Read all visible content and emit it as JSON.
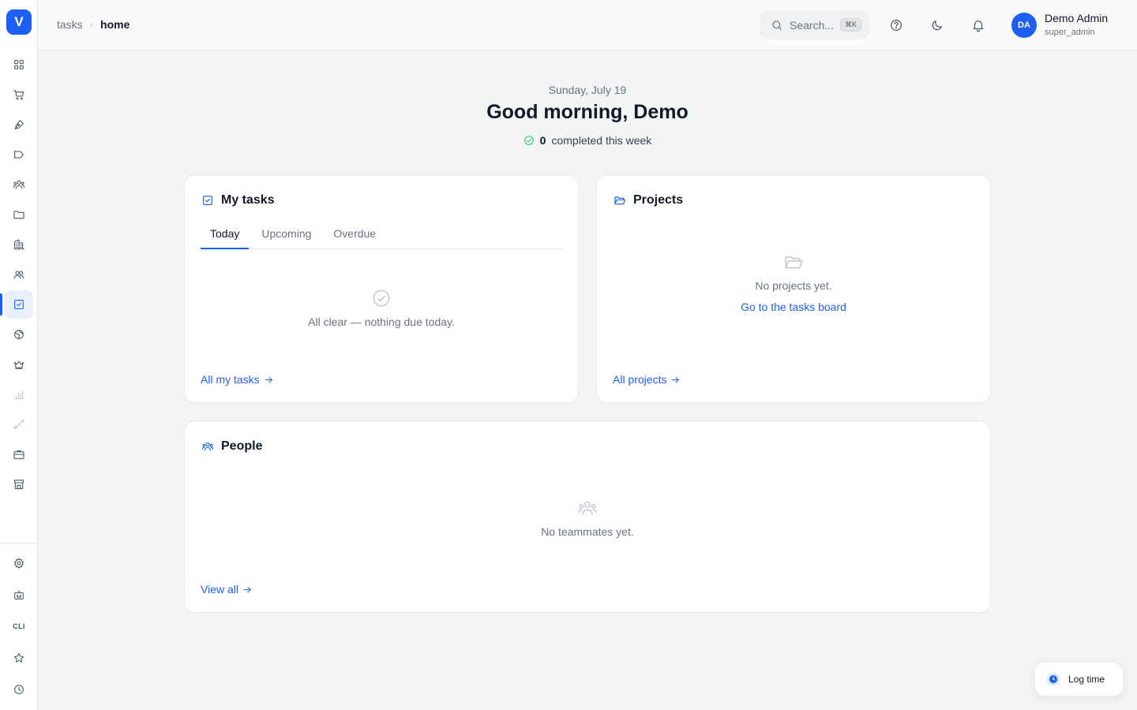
{
  "app": {
    "logo_letter": "V"
  },
  "sidebar": {
    "items": [
      {
        "name": "dashboard",
        "icon": "grid-icon"
      },
      {
        "name": "shop",
        "icon": "cart-icon"
      },
      {
        "name": "content",
        "icon": "pen-nib-icon"
      },
      {
        "name": "campaigns",
        "icon": "megaphone-icon"
      },
      {
        "name": "users",
        "icon": "users-icon"
      },
      {
        "name": "files",
        "icon": "folder-icon"
      },
      {
        "name": "companies",
        "icon": "building-icon"
      },
      {
        "name": "team",
        "icon": "team-icon"
      },
      {
        "name": "tasks",
        "icon": "checkbox-icon",
        "active": true
      },
      {
        "name": "sites",
        "icon": "globe-icon"
      },
      {
        "name": "membership",
        "icon": "crown-icon"
      },
      {
        "name": "analytics",
        "icon": "bar-chart-icon",
        "disabled": true
      },
      {
        "name": "integrations",
        "icon": "route-icon",
        "disabled": true
      },
      {
        "name": "jobs",
        "icon": "briefcase-icon"
      },
      {
        "name": "storefront",
        "icon": "store-icon"
      }
    ],
    "bottom": [
      {
        "name": "settings",
        "icon": "gear-icon"
      },
      {
        "name": "bot",
        "icon": "robot-icon"
      },
      {
        "name": "cli",
        "label": "CLI"
      },
      {
        "name": "favorites",
        "icon": "star-icon"
      },
      {
        "name": "history",
        "icon": "clock-icon"
      }
    ]
  },
  "topbar": {
    "breadcrumb": {
      "parent": "tasks",
      "current": "home"
    },
    "search": {
      "placeholder": "Search...",
      "shortcut": "⌘K"
    },
    "user": {
      "initials": "DA",
      "name": "Demo Admin",
      "role": "super_admin"
    }
  },
  "greeting": {
    "date": "Sunday, July 19",
    "title": "Good morning, Demo",
    "completed_count": "0",
    "completed_label": "completed this week"
  },
  "my_tasks": {
    "title": "My tasks",
    "tabs": [
      "Today",
      "Upcoming",
      "Overdue"
    ],
    "active_tab": "Today",
    "empty_text": "All clear — nothing due today.",
    "link": "All my tasks"
  },
  "projects": {
    "title": "Projects",
    "empty_text": "No projects yet.",
    "empty_link": "Go to the tasks board",
    "link": "All projects"
  },
  "people": {
    "title": "People",
    "empty_text": "No teammates yet.",
    "link": "View all"
  },
  "log_time": {
    "label": "Log time"
  },
  "colors": {
    "accent": "#1d5ff0",
    "success": "#22c55e",
    "background": "#f3f4f6"
  }
}
